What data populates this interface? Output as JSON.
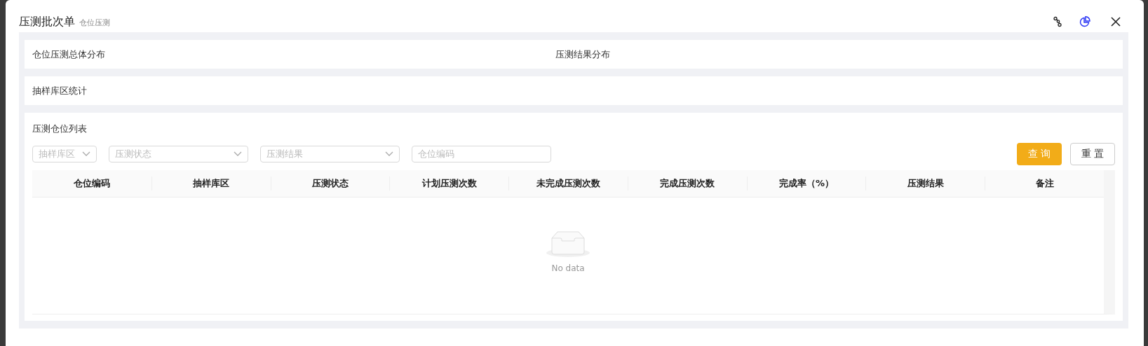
{
  "dialog": {
    "title": "压测批次单",
    "subtitle": "仓位压测"
  },
  "summary_panels": [
    "仓位压测总体分布",
    "压测结果分布"
  ],
  "stats_panel": {
    "title": "抽样库区统计"
  },
  "list_panel": {
    "title": "压测仓位列表",
    "filters": [
      {
        "kind": "select",
        "placeholder": "抽样库区"
      },
      {
        "kind": "select",
        "placeholder": "压测状态"
      },
      {
        "kind": "select",
        "placeholder": "压测结果"
      },
      {
        "kind": "input",
        "placeholder": "仓位编码"
      }
    ],
    "buttons": [
      {
        "label": "查 询",
        "kind": "primary"
      },
      {
        "label": "重 置",
        "kind": "default"
      }
    ],
    "table": {
      "columns": [
        "仓位编码",
        "抽样库区",
        "压测状态",
        "计划压测次数",
        "未完成压测次数",
        "完成压测次数",
        "完成率（%）",
        "压测结果",
        "备注"
      ],
      "empty_text": "No data"
    }
  }
}
